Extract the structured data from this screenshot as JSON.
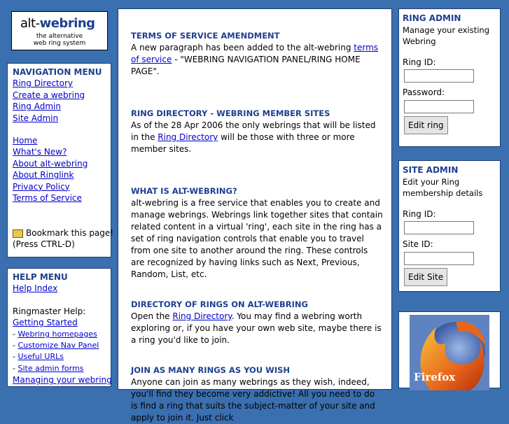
{
  "logo": {
    "brand_alt": "alt-",
    "brand_main": "webring",
    "tag1": "the alternative",
    "tag2": "web ring system"
  },
  "nav": {
    "title": "NAVIGATION MENU",
    "links1": [
      "Ring Directory",
      "Create a webring",
      "Ring Admin",
      "Site Admin"
    ],
    "links2": [
      "Home",
      "What's New?",
      "About alt-webring",
      "About Ringlink",
      "Privacy Policy",
      "Terms of Service"
    ],
    "bookmark": "Bookmark this page!",
    "bookmark_hint": "(Press CTRL-D)"
  },
  "help": {
    "title": "HELP MENU",
    "index": "Help Index",
    "ringmaster": "Ringmaster Help:",
    "getting_started": "Getting Started",
    "sub": [
      "Webring homepages",
      "Customize Nav Panel",
      "Useful URLs",
      "Site admin forms"
    ],
    "managing": "Managing your webring"
  },
  "main": {
    "s1": {
      "title": "TERMS OF SERVICE AMENDMENT",
      "t1": "A new paragraph has been added to the alt-webring ",
      "link": "terms of service",
      "t2": " - \"WEBRING NAVIGATION PANEL/RING HOME PAGE\"."
    },
    "s2": {
      "title": "RING DIRECTORY - WEBRING MEMBER SITES",
      "t1": "As of the 28 Apr 2006 the only webrings that will be listed in the ",
      "link": "Ring Directory",
      "t2": " will be those with three or more member sites."
    },
    "s3": {
      "title": "WHAT IS ALT-WEBRING?",
      "t1": "alt-webring is a free service that enables you to create and manage webrings. Webrings link together sites that contain related content in a virtual 'ring', each site in the ring has a set of ring navigation controls that enable you to travel from one site to another around the ring. These controls are recognized by having links such as Next, Previous, Random, List, etc."
    },
    "s4": {
      "title": "DIRECTORY OF RINGS ON ALT-WEBRING",
      "t1": "Open the ",
      "link": "Ring Directory",
      "t2": ". You may find a webring worth exploring or, if you have your own web site, maybe there is a ring you'd like to join."
    },
    "s5": {
      "title": "JOIN AS MANY RINGS AS YOU WISH",
      "t1": "Anyone can join as many webrings as they wish, indeed, you'll find they become very addictive! All you need to do is find a ring that suits the subject-matter of your site and apply to join it. Just click"
    }
  },
  "ring_admin": {
    "title": "RING ADMIN",
    "desc": "Manage your existing Webring",
    "ring_id": "Ring ID:",
    "password": "Password:",
    "button": "Edit ring"
  },
  "site_admin": {
    "title": "SITE ADMIN",
    "desc": "Edit your Ring membership details",
    "ring_id": "Ring ID:",
    "site_id": "Site ID:",
    "button": "Edit Site"
  },
  "firefox": {
    "label": "Firefox"
  },
  "colors": {
    "background": "#3a6fb0",
    "heading": "#1f3f8f",
    "link": "#0000cc"
  }
}
